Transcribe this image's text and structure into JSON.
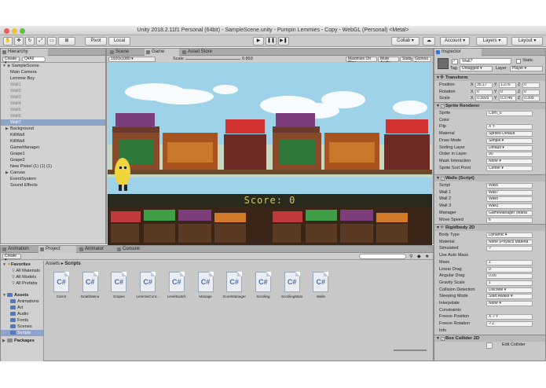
{
  "window": {
    "title": "Unity 2018.2.11f1 Personal (64bit) - SampleScene.unity - Pumpin Lemmies - Copy - WebGL (Personal) <Metal>"
  },
  "toolbar": {
    "pivot": "Pivot",
    "local": "Local",
    "collab": "Collab ▾",
    "account": "Account ▾",
    "layers": "Layers ▾",
    "layout": "Layout ▾"
  },
  "hierarchy": {
    "tab": "Hierarchy",
    "create": "Create ▾",
    "search_placeholder": "Q▾All",
    "scene": "SampleScene",
    "items": [
      {
        "label": "Main Camera",
        "indent": 1,
        "state": ""
      },
      {
        "label": "Lemmie Boy",
        "indent": 1,
        "state": ""
      },
      {
        "label": "Wall1",
        "indent": 1,
        "state": "dim"
      },
      {
        "label": "Wall2",
        "indent": 1,
        "state": "dim"
      },
      {
        "label": "Wall3",
        "indent": 1,
        "state": "dim"
      },
      {
        "label": "Wall4",
        "indent": 1,
        "state": "dim"
      },
      {
        "label": "Wall5",
        "indent": 1,
        "state": "dim"
      },
      {
        "label": "Wall6",
        "indent": 1,
        "state": "dim"
      },
      {
        "label": "Wall7",
        "indent": 1,
        "state": "sel"
      },
      {
        "label": "Background",
        "indent": 1,
        "state": "",
        "arrow": true
      },
      {
        "label": "KillWall",
        "indent": 1,
        "state": ""
      },
      {
        "label": "KillWall",
        "indent": 1,
        "state": ""
      },
      {
        "label": "GameManager",
        "indent": 1,
        "state": ""
      },
      {
        "label": "Grape1",
        "indent": 1,
        "state": ""
      },
      {
        "label": "Grape2",
        "indent": 1,
        "state": ""
      },
      {
        "label": "New Pixkel (1) (1) (1)",
        "indent": 1,
        "state": ""
      },
      {
        "label": "Canvas",
        "indent": 1,
        "state": "",
        "arrow": true
      },
      {
        "label": "EventSystem",
        "indent": 1,
        "state": ""
      },
      {
        "label": "Sound Effects",
        "indent": 1,
        "state": ""
      }
    ]
  },
  "center_tabs": {
    "scene": "Scene",
    "game": "Game",
    "asset_store": "Asset Store"
  },
  "game_bar": {
    "resolution": "1920x1080 ▾",
    "scale_label": "Scale",
    "scale_value": "0.893",
    "maximize": "Maximize On Play",
    "mute": "Mute Audio",
    "stats": "Stats",
    "gizmos": "Gizmos ▾"
  },
  "game": {
    "score": "Score: 0"
  },
  "bottom": {
    "tabs": [
      "Animation",
      "Project",
      "Animator",
      "Console"
    ],
    "create": "Create ▾",
    "breadcrumb_root": "Assets",
    "breadcrumb_sep": "▸",
    "breadcrumb_leaf": "Scripts",
    "favorites": "Favorites",
    "fav_items": [
      "All Materials",
      "All Models",
      "All Prefabs"
    ],
    "assets": "Assets",
    "asset_folders": [
      "Animations",
      "Art",
      "Audio",
      "Fonts",
      "Scenes",
      "Scripts"
    ],
    "packages": "Packages",
    "files": [
      "Carrot",
      "DeathMenu",
      "Grapes",
      "LemmieCont...",
      "LevelSwitch",
      "Manage",
      "ScoreManager",
      "Scrolling",
      "ScrollingMain",
      "Walls"
    ],
    "file_glyph": "C#"
  },
  "inspector": {
    "tab": "Inspector",
    "object_name": "Wall7",
    "static_label": "Static",
    "tag_label": "Tag",
    "tag_value": "Untagged ▾",
    "layer_label": "Layer",
    "layer_value": "Player ▾",
    "transform": {
      "title": "Transform",
      "position": {
        "label": "Position",
        "x": "35.17",
        "y": "1.276",
        "z": "0"
      },
      "rotation": {
        "label": "Rotation",
        "x": "0",
        "y": "0",
        "z": "0"
      },
      "scale": {
        "label": "Scale",
        "x": "0.3925",
        "y": "0.3746",
        "z": "0.305"
      }
    },
    "sprite_renderer": {
      "title": "Sprite Renderer",
      "rows": [
        {
          "label": "Sprite",
          "value": "Corn_0"
        },
        {
          "label": "Color",
          "value": ""
        },
        {
          "label": "Flip",
          "value": "X   Y"
        },
        {
          "label": "Material",
          "value": "Sprites-Default"
        },
        {
          "label": "Draw Mode",
          "value": "Simple ▾"
        },
        {
          "label": "Sorting Layer",
          "value": "Default ▾"
        },
        {
          "label": "Order in Layer",
          "value": "90"
        },
        {
          "label": "Mask Interaction",
          "value": "None ▾"
        },
        {
          "label": "Sprite Sort Point",
          "value": "Center ▾"
        }
      ]
    },
    "walls_script": {
      "title": "Walls (Script)",
      "rows": [
        {
          "label": "Script",
          "value": "Walls"
        },
        {
          "label": "Wall 1",
          "value": "Wall7"
        },
        {
          "label": "Wall 2",
          "value": "Wall5"
        },
        {
          "label": "Wall 3",
          "value": "Wall3"
        },
        {
          "label": "Manager",
          "value": "GameManager (Mana"
        },
        {
          "label": "Move Speed",
          "value": "6"
        }
      ]
    },
    "rigidbody": {
      "title": "Rigidbody 2D",
      "rows": [
        {
          "label": "Body Type",
          "value": "Dynamic ▾"
        },
        {
          "label": "Material",
          "value": "None (Physics Materia"
        },
        {
          "label": "Simulated",
          "value": "✓"
        },
        {
          "label": "Use Auto Mass",
          "value": ""
        },
        {
          "label": "Mass",
          "value": "1"
        },
        {
          "label": "Linear Drag",
          "value": "0"
        },
        {
          "label": "Angular Drag",
          "value": "0.05"
        },
        {
          "label": "Gravity Scale",
          "value": "1"
        },
        {
          "label": "Collision Detection",
          "value": "Discrete ▾"
        },
        {
          "label": "Sleeping Mode",
          "value": "Start Awake ▾"
        },
        {
          "label": "Interpolate",
          "value": "None ▾"
        },
        {
          "label": "Constraints",
          "value": ""
        },
        {
          "label": "Freeze Position",
          "value": "X ✓Y"
        },
        {
          "label": "Freeze Rotation",
          "value": "✓Z"
        },
        {
          "label": "Info",
          "value": ""
        }
      ]
    },
    "box_collider": {
      "title": "Box Collider 2D",
      "edit_collider": "Edit Collider"
    }
  },
  "colors": {
    "sky": "#9ed2e8",
    "lane": "#2a2a1c",
    "score": "#d6c36a",
    "selection": "#8da3c7"
  }
}
